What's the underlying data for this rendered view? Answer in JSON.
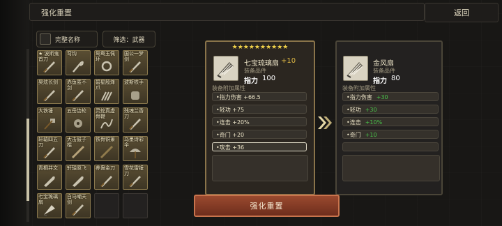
{
  "header": {
    "title": "强化重置",
    "back_label": "返回"
  },
  "filters": {
    "show_full_name_label": "完整名称",
    "filter_label": "筛选：武器"
  },
  "inventory": {
    "items": [
      {
        "name": "★ 波斯鬼首刀",
        "icon": "sword-icon"
      },
      {
        "name": "弯钩",
        "icon": "hook-icon"
      },
      {
        "name": "鸳鸯玉佩环",
        "icon": "ring-icon"
      },
      {
        "name": "国公一梦剑",
        "icon": "sword-icon"
      },
      {
        "name": "昊炫长剑",
        "icon": "sword-icon"
      },
      {
        "name": "赤鱼匿不剑",
        "icon": "sword-icon"
      },
      {
        "name": "碧星殷烽爪",
        "icon": "claw-icon"
      },
      {
        "name": "波斯铁手",
        "icon": "gauntlet-icon"
      },
      {
        "name": "大铁锤",
        "icon": "hammer-icon"
      },
      {
        "name": "五岳齿轮",
        "icon": "gear-icon"
      },
      {
        "name": "灵蛇真虚骨鞭",
        "icon": "whip-icon"
      },
      {
        "name": "残魂兰香刀",
        "icon": "sword-icon"
      },
      {
        "name": "轩辕四五刀",
        "icon": "sword-icon"
      },
      {
        "name": "大击鼓子棍",
        "icon": "staff-icon"
      },
      {
        "name": "铁骨铜箫",
        "icon": "flute-icon"
      },
      {
        "name": "乌墨诗彩伞",
        "icon": "umbrella-icon"
      },
      {
        "name": "青桐并文",
        "icon": "blade-icon"
      },
      {
        "name": "轩辕原飞",
        "icon": "blade-icon"
      },
      {
        "name": "养蛊金刀",
        "icon": "sword-icon"
      },
      {
        "name": "雪花雷锤刀",
        "icon": "sword-icon"
      },
      {
        "name": "七宝琉璃扇",
        "icon": "fan-icon"
      },
      {
        "name": "白马嘲天剑",
        "icon": "sword-icon"
      },
      {
        "name": "",
        "icon": ""
      },
      {
        "name": "",
        "icon": ""
      }
    ]
  },
  "current_item": {
    "stars": "★★★★★★★★★★",
    "name": "七宝琉璃扇",
    "level": "+10",
    "type": "装备品件",
    "power_label": "指力",
    "power_value": "100",
    "attr_heading": "装备附加属性",
    "attributes": [
      "•指力伤害 +66.5",
      "•轻功 +75",
      "•连击 +20%",
      "•奇门 +20",
      "•攻击 +36"
    ]
  },
  "target_item": {
    "name": "金风扇",
    "type": "装备品件",
    "power_label": "指力",
    "power_value": "80",
    "attr_heading": "装备附加属性",
    "attributes": [
      {
        "label": "•指力伤害",
        "value": "+30"
      },
      {
        "label": "•轻功",
        "value": "+30"
      },
      {
        "label": "•连击",
        "value": "+10%"
      },
      {
        "label": "•奇门",
        "value": "+10"
      }
    ]
  },
  "reforge_label": "强化重置",
  "colors": {
    "accent_gold": "#e0b945",
    "bonus_green": "#49c24a",
    "button_red": "#9a4a2f"
  }
}
